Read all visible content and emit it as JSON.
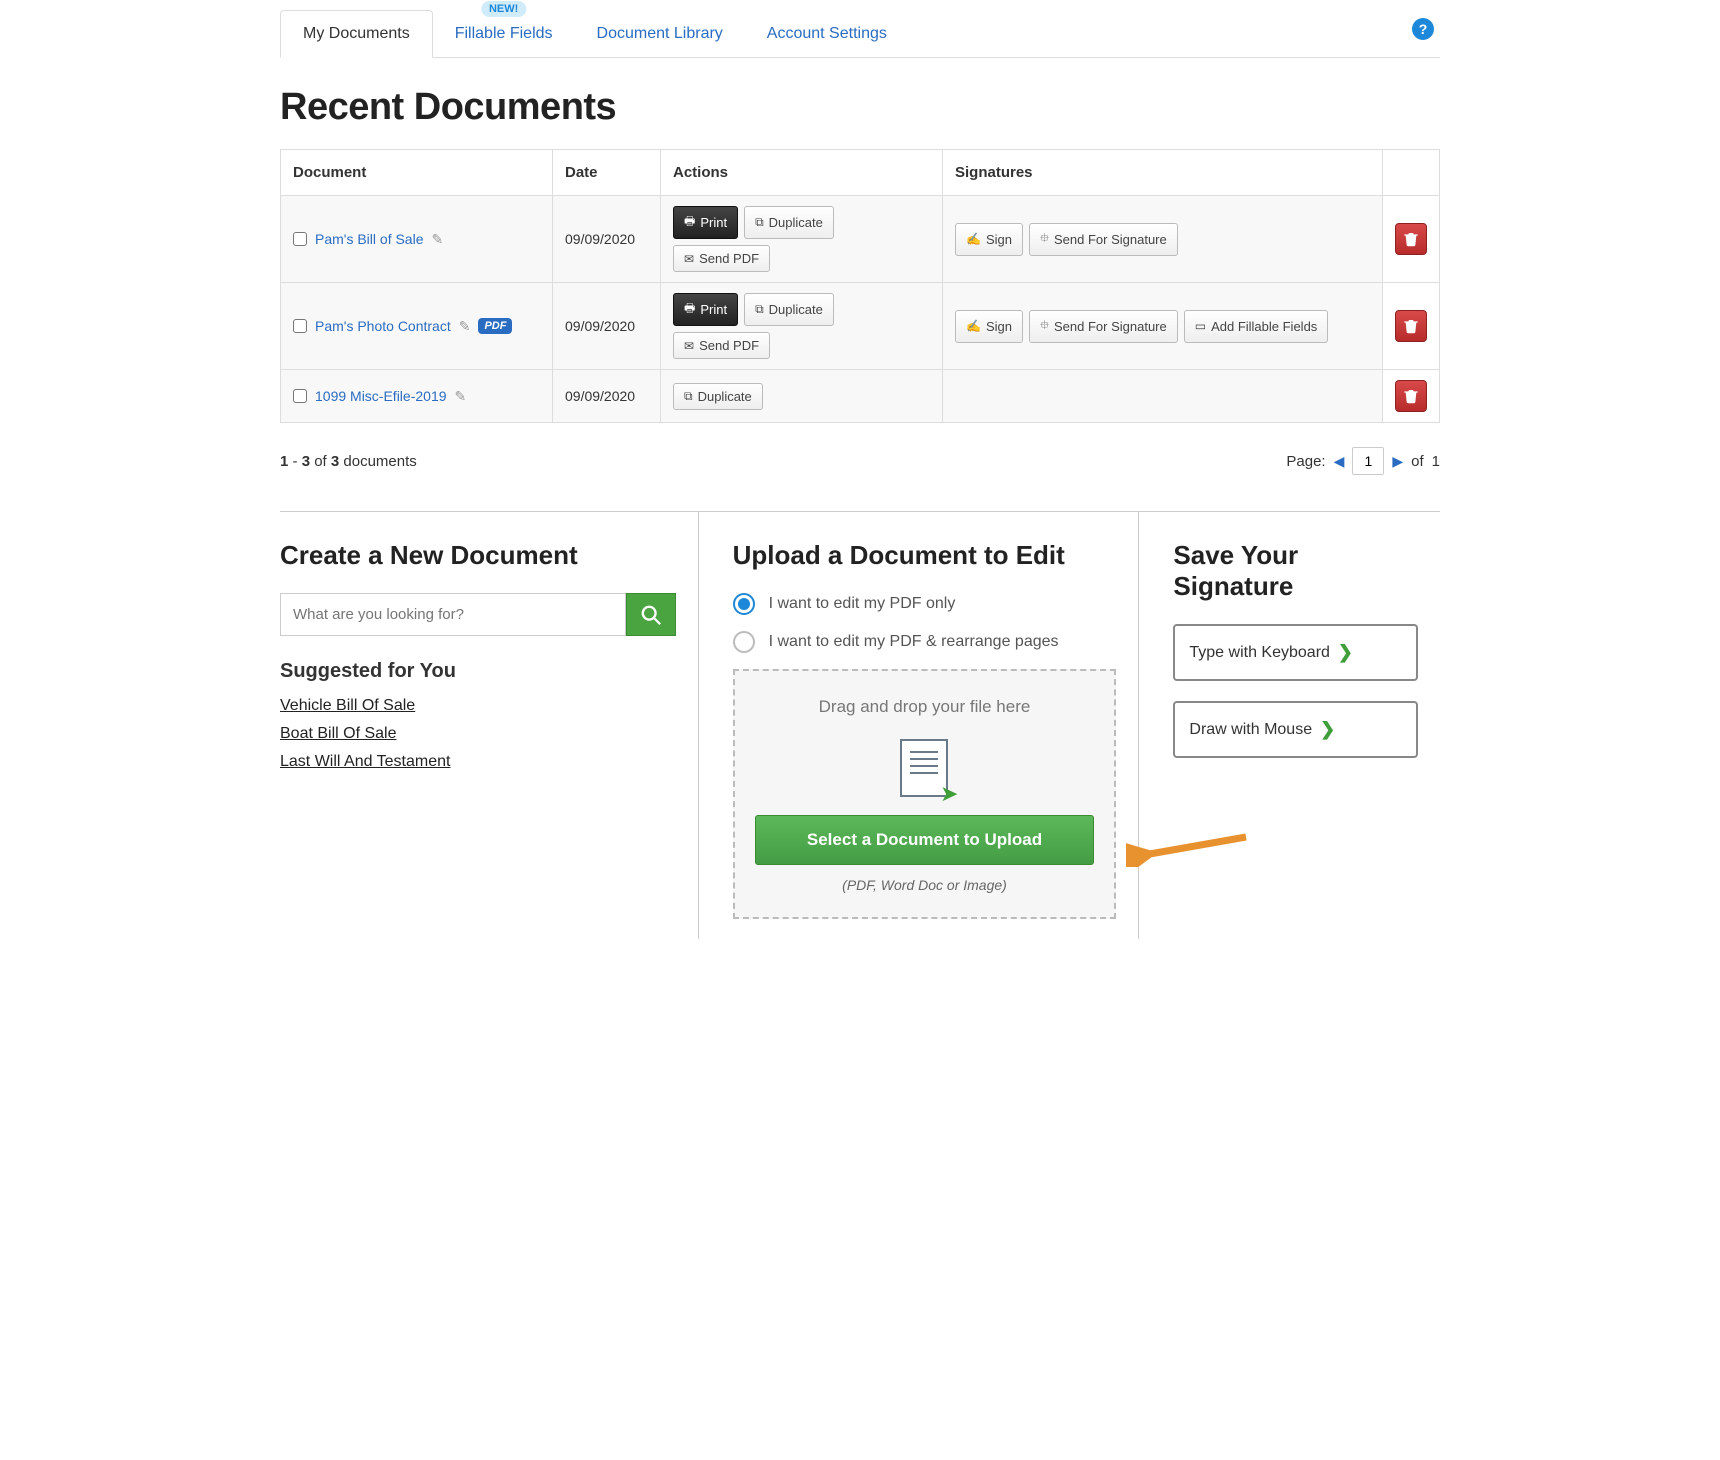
{
  "tabs": [
    {
      "label": "My Documents",
      "active": true
    },
    {
      "label": "Fillable Fields",
      "active": false,
      "badge": "NEW!"
    },
    {
      "label": "Document Library",
      "active": false
    },
    {
      "label": "Account Settings",
      "active": false
    }
  ],
  "heading": "Recent Documents",
  "table": {
    "headers": {
      "document": "Document",
      "date": "Date",
      "actions": "Actions",
      "signatures": "Signatures"
    },
    "rows": [
      {
        "name": "Pam's Bill of Sale",
        "date": "09/09/2020",
        "pdf_badge": false,
        "has_full_actions": true,
        "has_sig": true,
        "has_fillable": false
      },
      {
        "name": "Pam's Photo Contract",
        "date": "09/09/2020",
        "pdf_badge": true,
        "has_full_actions": true,
        "has_sig": true,
        "has_fillable": true
      },
      {
        "name": "1099 Misc-Efile-2019",
        "date": "09/09/2020",
        "pdf_badge": false,
        "has_full_actions": false,
        "has_sig": false,
        "has_fillable": false
      }
    ]
  },
  "action_labels": {
    "print": "Print",
    "duplicate": "Duplicate",
    "sendpdf": "Send PDF",
    "sign": "Sign",
    "sendforsig": "Send For Signature",
    "addfillable": "Add Fillable Fields"
  },
  "pagination": {
    "summary_pre": "1",
    "summary_mid": " - ",
    "summary_b": "3",
    "summary_of": " of ",
    "summary_total": "3",
    "summary_suf": " documents",
    "page_label": "Page:",
    "page_value": "1",
    "of_label": "of",
    "total_pages": "1"
  },
  "create": {
    "title": "Create a New Document",
    "search_placeholder": "What are you looking for?",
    "suggested_title": "Suggested for You",
    "suggestions": [
      "Vehicle Bill Of Sale",
      "Boat Bill Of Sale",
      "Last Will And Testament"
    ]
  },
  "upload": {
    "title": "Upload a Document to Edit",
    "opt1": "I want to edit my PDF only",
    "opt2": "I want to edit my PDF & rearrange pages",
    "drop_text": "Drag and drop your file here",
    "button": "Select a Document to Upload",
    "sub": "(PDF, Word Doc or Image)"
  },
  "signature": {
    "title": "Save Your Signature",
    "type_btn": "Type with Keyboard",
    "draw_btn": "Draw with Mouse"
  },
  "pdf_badge_text": "PDF"
}
